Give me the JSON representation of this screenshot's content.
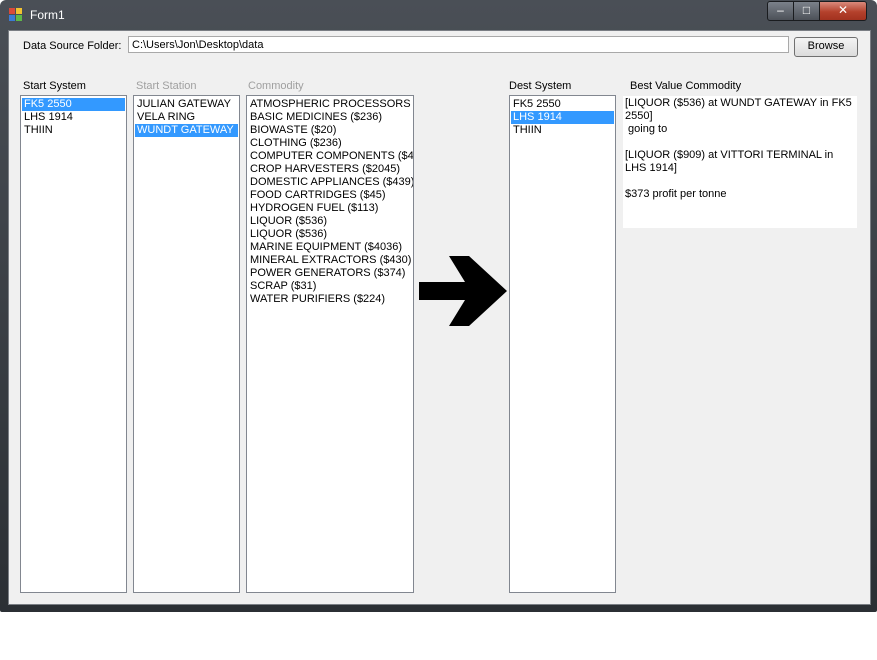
{
  "window": {
    "title": "Form1",
    "minimize_glyph": "–",
    "maximize_glyph": "□",
    "close_glyph": "✕"
  },
  "source": {
    "label": "Data Source Folder:",
    "path": "C:\\Users\\Jon\\Desktop\\data",
    "browse_label": "Browse"
  },
  "start_system": {
    "label": "Start System",
    "items": [
      "FK5 2550",
      "LHS 1914",
      "THIIN"
    ],
    "selected": 0
  },
  "start_station": {
    "label": "Start Station",
    "items": [
      "JULIAN GATEWAY",
      "VELA RING",
      "WUNDT GATEWAY"
    ],
    "selected": 2
  },
  "commodity": {
    "label": "Commodity",
    "items": [
      "ATMOSPHERIC PROCESSORS (",
      "BASIC MEDICINES ($236)",
      "BIOWASTE ($20)",
      "CLOTHING ($236)",
      "COMPUTER COMPONENTS ($43",
      "CROP HARVESTERS ($2045)",
      "DOMESTIC APPLIANCES ($439)",
      "FOOD CARTRIDGES ($45)",
      "HYDROGEN FUEL ($113)",
      "LIQUOR ($536)",
      "LIQUOR ($536)",
      "MARINE EQUIPMENT ($4036)",
      "MINERAL EXTRACTORS ($430)",
      "POWER GENERATORS ($374)",
      "SCRAP ($31)",
      "WATER PURIFIERS ($224)"
    ]
  },
  "dest_system": {
    "label": "Dest System",
    "items": [
      "FK5 2550",
      "LHS 1914",
      "THIIN"
    ],
    "selected": 1
  },
  "best_value": {
    "label": "Best Value Commodity",
    "line1": "[LIQUOR ($536) at WUNDT GATEWAY in FK5 2550]",
    "line2": " going to",
    "line3": "[LIQUOR ($909) at VITTORI TERMINAL in LHS 1914]",
    "line4": "$373 profit per tonne"
  },
  "icons": {
    "app": "app-form-icon",
    "arrow": "right-arrow-icon"
  }
}
